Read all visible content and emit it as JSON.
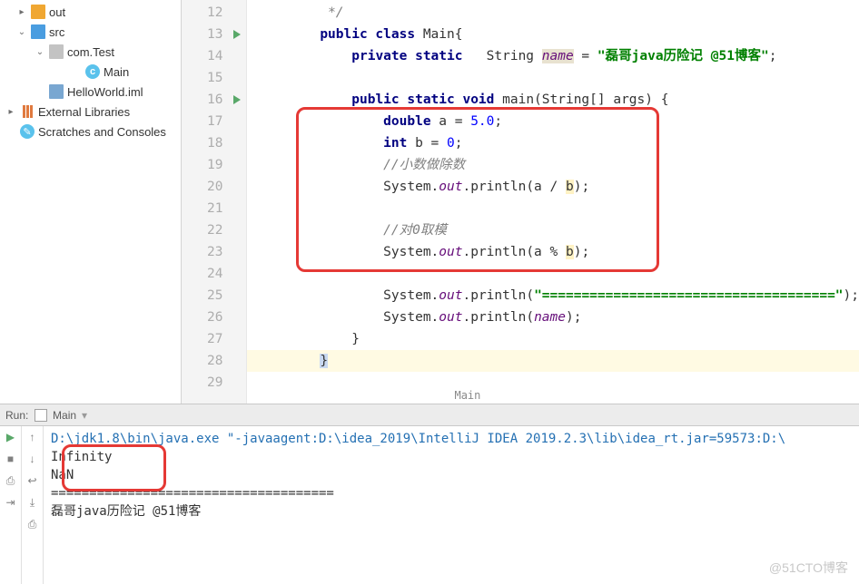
{
  "tree": {
    "out": "out",
    "src": "src",
    "pkg": "com.Test",
    "main": "Main",
    "iml": "HelloWorld.iml",
    "ext": "External Libraries",
    "scratch": "Scratches and Consoles"
  },
  "gutter": [
    "12",
    "13",
    "14",
    "15",
    "16",
    "17",
    "18",
    "19",
    "20",
    "21",
    "22",
    "23",
    "24",
    "25",
    "26",
    "27",
    "28",
    "29"
  ],
  "code": {
    "l12": "*/",
    "l13_a": "public class ",
    "l13_b": "Main{",
    "l14_a": "private static",
    "l14_b": "   String ",
    "l14_c": "name",
    "l14_d": " = ",
    "l14_e": "\"磊哥java历险记 @51博客\"",
    "l14_f": ";",
    "l16_a": "public static void ",
    "l16_b": "main(String[] args) {",
    "l17_a": "double ",
    "l17_b": "a = ",
    "l17_c": "5.0",
    "l17_d": ";",
    "l18_a": "int ",
    "l18_b": "b = ",
    "l18_c": "0",
    "l18_d": ";",
    "l19": "//小数做除数",
    "l20_a": "System.",
    "l20_b": "out",
    "l20_c": ".println(a / ",
    "l20_d": "b",
    "l20_e": ");",
    "l22": "//对0取模",
    "l23_a": "System.",
    "l23_b": "out",
    "l23_c": ".println(a % ",
    "l23_d": "b",
    "l23_e": ");",
    "l25_a": "System.",
    "l25_b": "out",
    "l25_c": ".println(",
    "l25_d": "\"=====================================\"",
    "l25_e": ");",
    "l26_a": "System.",
    "l26_b": "out",
    "l26_c": ".println(",
    "l26_d": "name",
    "l26_e": ");",
    "l27": "}",
    "l28": "}"
  },
  "crumb": "Main",
  "run": {
    "label": "Run:",
    "tab": "Main",
    "cmd": "D:\\jdk1.8\\bin\\java.exe \"-javaagent:D:\\idea_2019\\IntelliJ IDEA 2019.2.3\\lib\\idea_rt.jar=59573:D:\\",
    "out1": "Infinity",
    "out2": "NaN",
    "out3": "=====================================",
    "out4": "磊哥java历险记 @51博客"
  },
  "watermark": "@51CTO博客"
}
